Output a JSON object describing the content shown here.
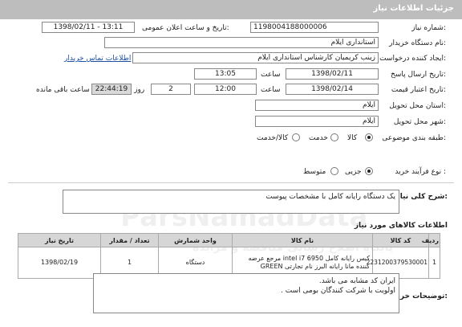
{
  "header": {
    "title": "جزئیات اطلاعات نیاز"
  },
  "form": {
    "need_number": {
      "label": "شماره نیاز:",
      "value": "1198004188000006"
    },
    "announce": {
      "label": "تاریخ و ساعت اعلان عمومی:",
      "value": "1398/02/11 - 13:11"
    },
    "buyer_org": {
      "label": "نام دستگاه خریدار:",
      "value": "استانداری ایلام"
    },
    "creator": {
      "label": "ایجاد کننده درخواست:",
      "value": "زینب کریمیان کارشناس استانداری ایلام",
      "contact_link": "اطلاعات تماس خریدار"
    },
    "response_deadline": {
      "label": "تاریخ ارسال پاسخ:",
      "date": "1398/02/11",
      "time_label": "ساعت",
      "time": "13:05"
    },
    "price_validity": {
      "label": "تاریخ اعتبار قیمت:",
      "date": "1398/02/14",
      "time_label": "ساعت",
      "time": "12:00",
      "days": "2",
      "days_label": "روز و",
      "remaining": "22:44:19",
      "remaining_label": "ساعت باقی مانده"
    },
    "province": {
      "label": "استان محل تحویل:",
      "value": "ایلام"
    },
    "city": {
      "label": "شهر محل تحویل:",
      "value": "ایلام"
    },
    "category": {
      "label": "طبقه بندی موضوعی:",
      "options": [
        "کالا",
        "خدمت",
        "کالا/خدمت"
      ],
      "selected": "کالا"
    },
    "process": {
      "label": "نوع فرآیند خرید :",
      "options": [
        "جزیی",
        "متوسط"
      ],
      "selected": "جزیی"
    }
  },
  "summary": {
    "label": "شرح کلی نیاز:",
    "value": "یک دستگاه رایانه کامل با مشخصات پیوست"
  },
  "goods": {
    "title": "اطلاعات کالاهای مورد نیاز",
    "columns": [
      "ردیف",
      "کد کالا",
      "نام کالا",
      "واحد شمارش",
      "تعداد / مقدار",
      "تاریخ نیاز"
    ],
    "rows": [
      {
        "row": "1",
        "code": "2231200379530001",
        "name": "کیس رایانه کامل intel i7 6950 مرجع عرضه کننده مانا رایانه البرز نام تجارتی GREEN",
        "unit": "دستگاه",
        "qty": "1",
        "date": "1398/02/19"
      }
    ]
  },
  "notes": {
    "label": "توضیحات خریدار:",
    "lines": [
      "ایران کد مشابه می باشد.",
      "اولویت با شرکت کنندگان بومی است ."
    ]
  },
  "watermarks": [
    "ParsNamadData",
    "پایگاه اطلاع رسانی مناقصه و مزایده"
  ]
}
